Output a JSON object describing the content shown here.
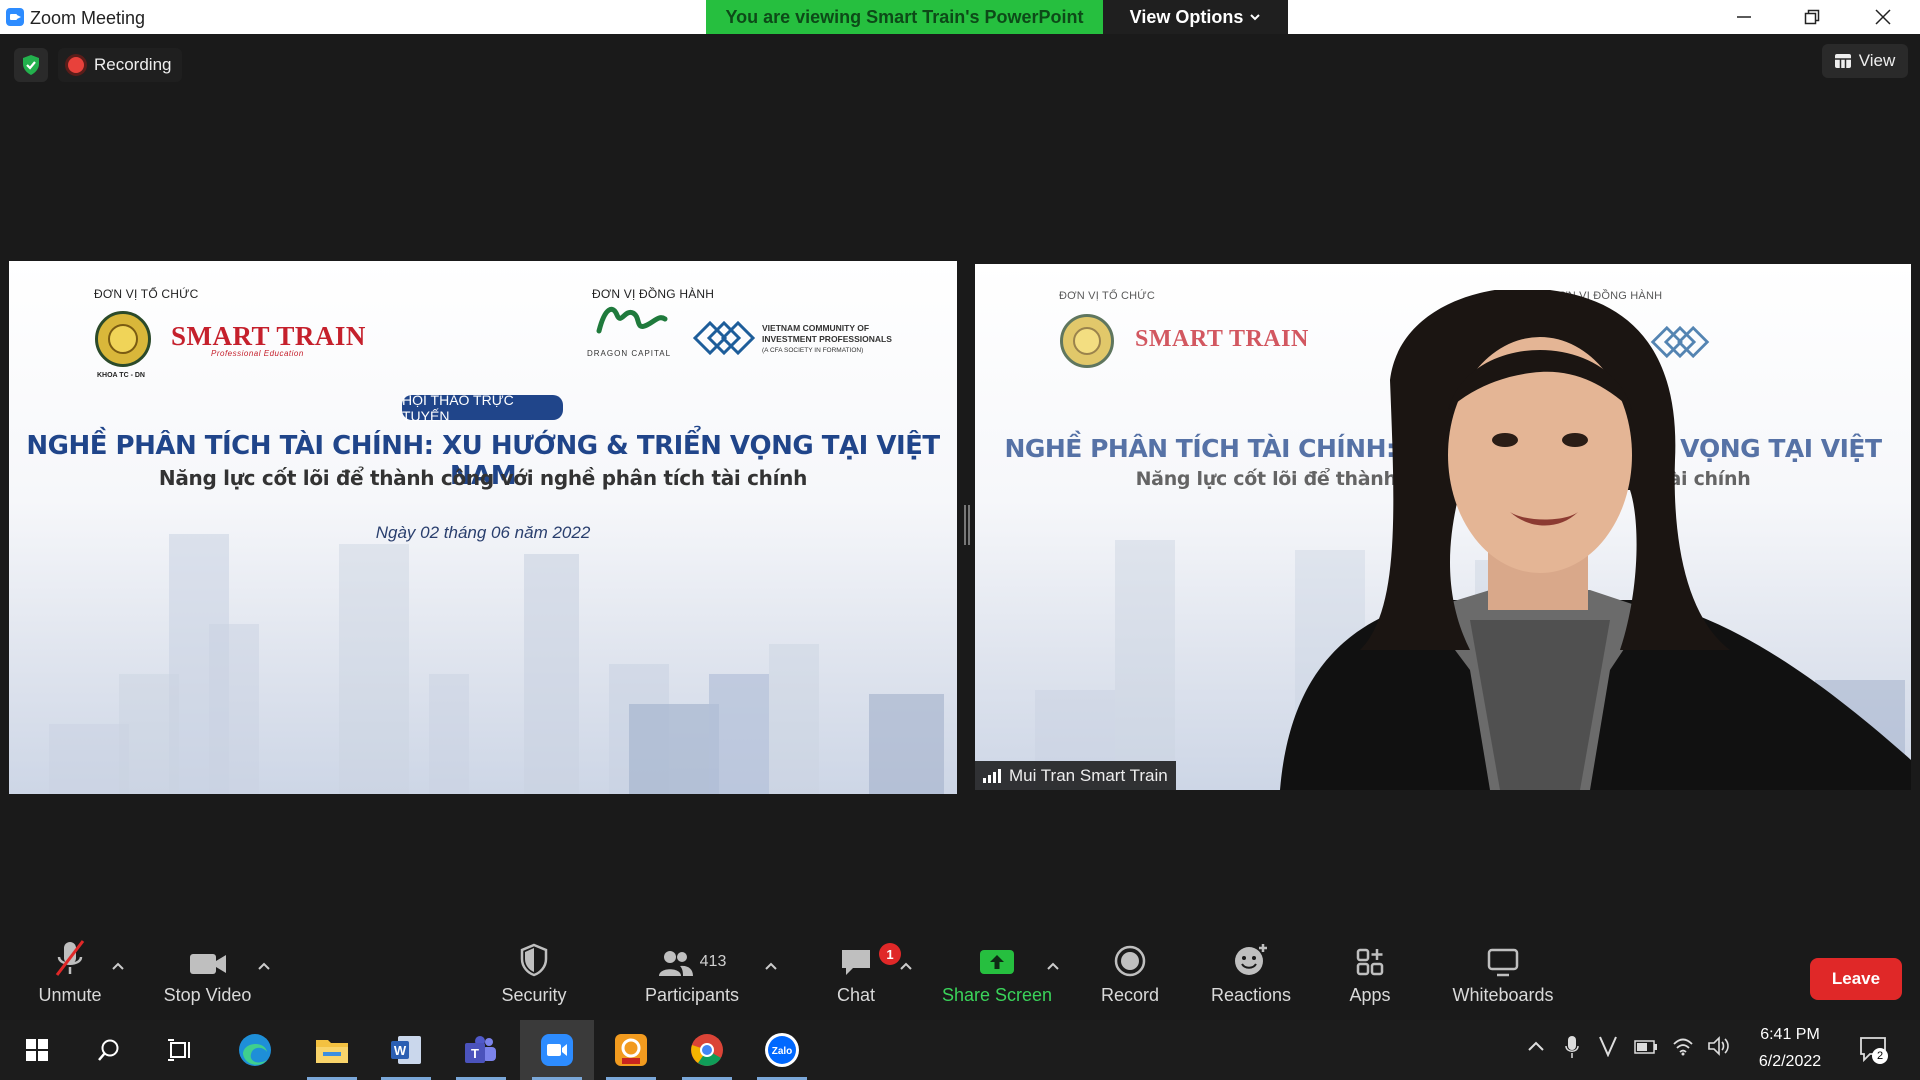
{
  "window": {
    "title": "Zoom Meeting"
  },
  "share_banner": {
    "text": "You are viewing Smart Train's PowerPoint",
    "view_options": "View Options"
  },
  "status": {
    "recording": "Recording",
    "view": "View"
  },
  "slide": {
    "organizer_label": "ĐƠN VỊ TỔ CHỨC",
    "partner_label": "ĐƠN VỊ ĐỒNG HÀNH",
    "org_logo_caption": "KHOA TC - DN",
    "smart_train": "SMART TRAIN",
    "smart_train_tagline": "Professional Education",
    "dragon_capital": "DRAGON CAPITAL",
    "vcip": [
      "VIETNAM COMMUNITY OF",
      "INVESTMENT PROFESSIONALS",
      "(A CFA SOCIETY IN FORMATION)"
    ],
    "badge": "HỘI THẢO TRỰC TUYẾN",
    "title": "NGHỀ PHÂN TÍCH TÀI CHÍNH: XU HƯỚNG & TRIỂN VỌNG TẠI VIỆT NAM",
    "subtitle": "Năng lực cốt lõi để thành công với nghề phân tích tài chính",
    "date": "Ngày 02 tháng 06 năm 2022"
  },
  "video": {
    "participant_name": "Mui Tran Smart Train"
  },
  "toolbar": {
    "unmute": "Unmute",
    "stop_video": "Stop Video",
    "security": "Security",
    "participants": "Participants",
    "participants_count": "413",
    "chat": "Chat",
    "chat_badge": "1",
    "share_screen": "Share Screen",
    "record": "Record",
    "reactions": "Reactions",
    "apps": "Apps",
    "whiteboards": "Whiteboards",
    "leave": "Leave"
  },
  "taskbar": {
    "apps": [
      "start-icon",
      "search-icon",
      "task-view-icon",
      "edge-icon",
      "file-explorer-icon",
      "word-icon",
      "teams-icon",
      "zoom-icon",
      "pdf-app-icon",
      "chrome-icon",
      "zalo-icon"
    ],
    "time": "6:41 PM",
    "date": "6/2/2022",
    "notification_count": "2",
    "zalo_label": "Zalo",
    "pdf_label": "PDF"
  },
  "colors": {
    "share_green": "#26bf3f",
    "leave_red": "#e02828",
    "slide_blue": "#20458a",
    "smart_train_red": "#c5202c"
  }
}
